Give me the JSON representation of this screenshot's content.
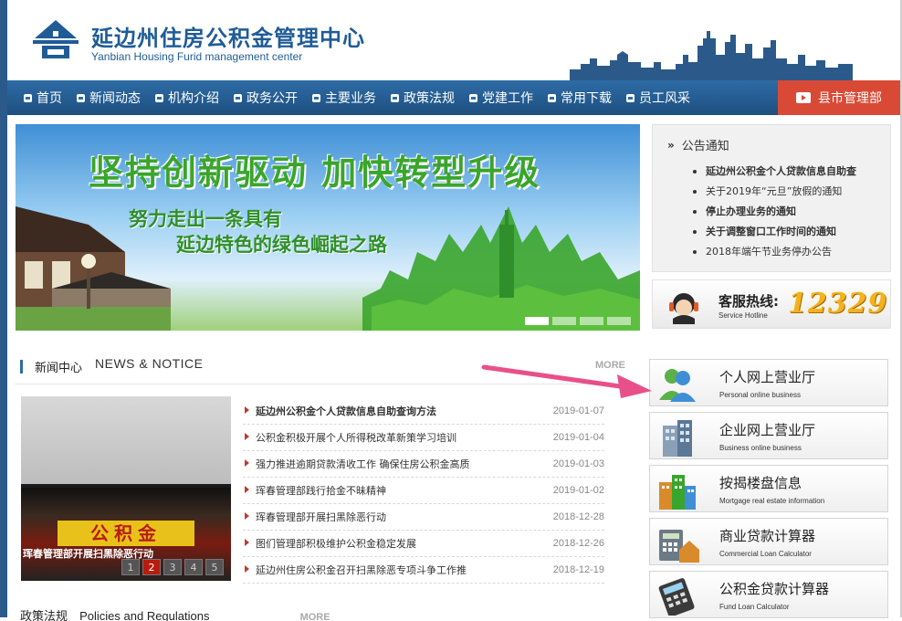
{
  "header": {
    "title": "延边州住房公积金管理中心",
    "subtitle": "Yanbian Housing Furid management center"
  },
  "nav": {
    "items": [
      "首页",
      "新闻动态",
      "机构介绍",
      "政务公开",
      "主要业务",
      "政策法规",
      "党建工作",
      "常用下载",
      "员工风采"
    ],
    "county": "县市管理部"
  },
  "banner": {
    "title": "坚持创新驱动 加快转型升级",
    "line1": "努力走出一条具有",
    "line2": "延边特色的绿色崛起之路"
  },
  "notice": {
    "heading": "公告通知",
    "items": [
      "延边州公积金个人贷款信息自助查",
      "关于2019年“元旦”放假的通知",
      "停止办理业务的通知",
      "关于调整窗口工作时间的通知",
      "2018年端午节业务停办公告"
    ]
  },
  "hotline": {
    "label": "客服热线:",
    "sub": "Service Hotline",
    "number": "12329"
  },
  "news": {
    "title": "新闻中心",
    "title_en": "NEWS & NOTICE",
    "more": "MORE",
    "photo_sign": "公积金",
    "photo_caption": "珲春管理部开展扫黑除恶行动",
    "pager": [
      "1",
      "2",
      "3",
      "4",
      "5"
    ],
    "items": [
      {
        "title": "延边州公积金个人贷款信息自助查询方法",
        "date": "2019-01-07"
      },
      {
        "title": "公积金积极开展个人所得税改革新策学习培训",
        "date": "2019-01-04"
      },
      {
        "title": "强力推进逾期贷款清收工作 确保住房公积金高质",
        "date": "2019-01-03"
      },
      {
        "title": "珲春管理部践行拾金不昧精神",
        "date": "2019-01-02"
      },
      {
        "title": "珲春管理部开展扫黑除恶行动",
        "date": "2018-12-28"
      },
      {
        "title": "图们管理部积极维护公积金稳定发展",
        "date": "2018-12-26"
      },
      {
        "title": "延边州住房公积金召开扫黑除恶专项斗争工作推",
        "date": "2018-12-19"
      }
    ]
  },
  "policy": {
    "title": "政策法规",
    "title_en": "Policies and Regulations",
    "more": "MORE"
  },
  "services": [
    {
      "title": "个人网上营业厅",
      "sub": "Personal online business"
    },
    {
      "title": "企业网上营业厅",
      "sub": "Business online business"
    },
    {
      "title": "按揭楼盘信息",
      "sub": "Mortgage real estate information"
    },
    {
      "title": "商业贷款计算器",
      "sub": "Commercial Loan Calculator"
    },
    {
      "title": "公积金贷款计算器",
      "sub": "Fund Loan Calculator"
    }
  ],
  "colors": {
    "brand_blue": "#1f5c97",
    "nav_blue": "#2d6ca5",
    "county_red": "#d94a36",
    "hotline_gold": "#f2b21e",
    "arrow_pink": "#e8508a"
  }
}
